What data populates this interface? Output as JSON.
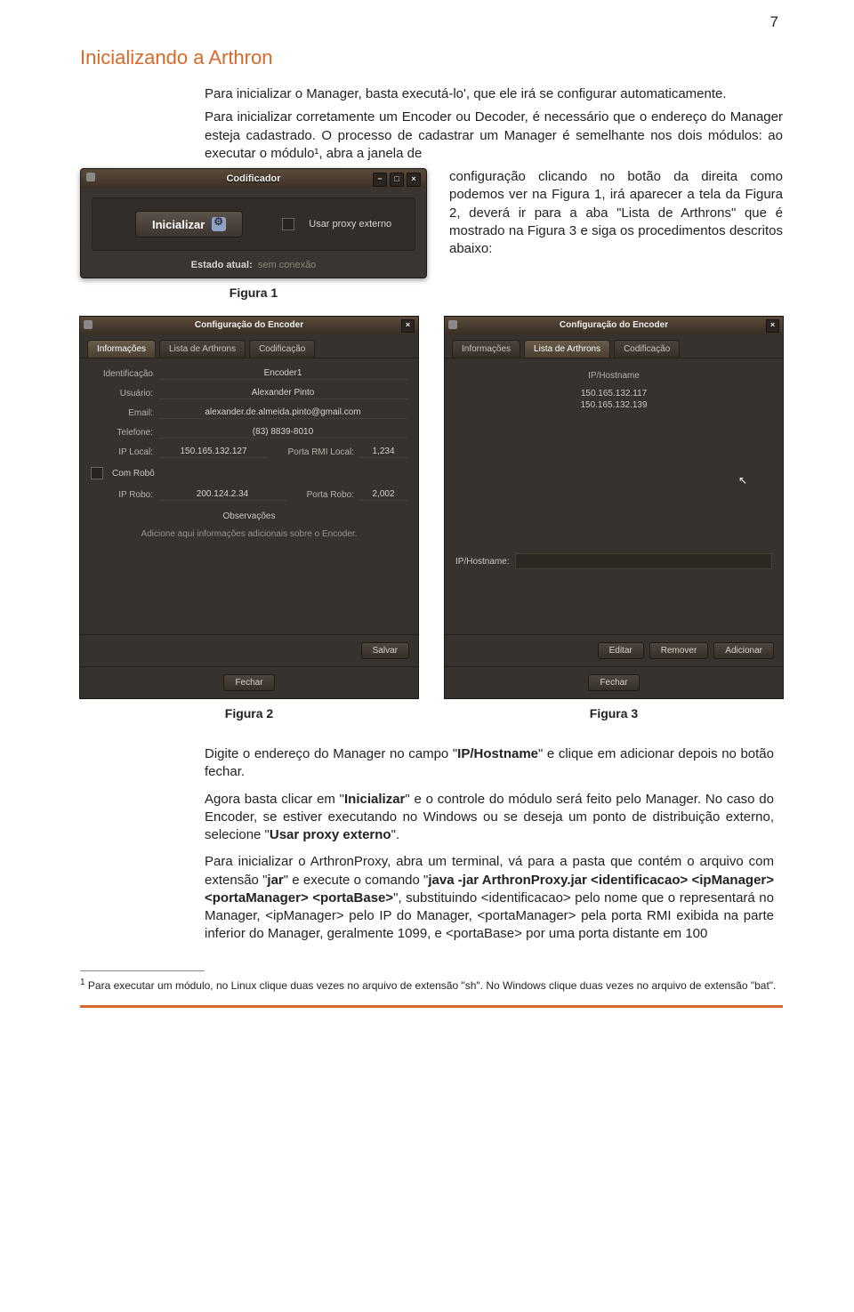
{
  "page_number": "7",
  "heading": "Inicializando a Arthron",
  "para1": "Para inicializar o Manager, basta executá-lo', que ele irá se configurar automaticamente.",
  "para2": "Para inicializar corretamente um Encoder ou Decoder, é necessário que o endereço do Manager esteja cadastrado. O processo de cadastrar um Manager é semelhante nos dois módulos: ao executar o módulo¹, abra a janela de",
  "para2b": "configuração clicando no botão da direita como podemos ver na Figura 1, irá aparecer a tela da Figura 2, deverá ir para a aba \"Lista de Arthrons\" que é mostrado na Figura 3 e siga os procedimentos descritos abaixo:",
  "fig1": {
    "title": "Codificador",
    "init_btn": "Inicializar",
    "proxy_label": "Usar proxy externo",
    "status_label": "Estado atual:",
    "status_value": "sem conexão",
    "caption": "Figura 1"
  },
  "fig2": {
    "title": "Configuração do Encoder",
    "tabs": {
      "info": "Informações",
      "lista": "Lista de Arthrons",
      "cod": "Codificação"
    },
    "labels": {
      "ident": "Identificação",
      "user": "Usuário:",
      "email": "Email:",
      "tel": "Telefone:",
      "iplocal": "IP Local:",
      "porta_rmi": "Porta RMI Local:",
      "com_robo": "Com Robô",
      "ip_robo": "IP Robo:",
      "porta_robo": "Porta Robo:",
      "obs": "Observações"
    },
    "vals": {
      "ident": "Encoder1",
      "user": "Alexander Pinto",
      "email": "alexander.de.almeida.pinto@gmail.com",
      "tel": "(83) 8839-8010",
      "iplocal": "150.165.132.127",
      "porta_rmi": "1,234",
      "ip_robo": "200.124.2.34",
      "porta_robo": "2,002",
      "obs": "Adicione aqui informações adicionais sobre o Encoder."
    },
    "save": "Salvar",
    "close": "Fechar",
    "caption": "Figura 2"
  },
  "fig3": {
    "title": "Configuração do Encoder",
    "col": "IP/Hostname",
    "ips": [
      "150.165.132.117",
      "150.165.132.139"
    ],
    "iphost_label": "IP/Hostname:",
    "btns": {
      "edit": "Editar",
      "rem": "Remover",
      "add": "Adicionar"
    },
    "close": "Fechar",
    "caption": "Figura 3"
  },
  "body": {
    "p1a": "Digite o endereço do Manager no campo \"",
    "p1b": "IP/Hostname",
    "p1c": "\" e clique em adicionar depois no botão fechar.",
    "p2a": "Agora basta clicar em \"",
    "p2b": "Inicializar",
    "p2c": "\" e o controle do módulo será feito pelo Manager. No caso do Encoder, se estiver executando no Windows ou se deseja um ponto de distribuição externo, selecione \"",
    "p2d": "Usar proxy externo",
    "p2e": "\".",
    "p3a": "Para inicializar o ArthronProxy, abra um terminal, vá para a pasta que contém o arquivo com extensão \"",
    "p3b": "jar",
    "p3c": "\" e execute o comando \"",
    "p3d": "java -jar ArthronProxy.jar <identificacao> <ipManager> <portaManager> <portaBase>",
    "p3e": "\", substituindo <identificacao> pelo nome que o representará no Manager, <ipManager> pelo IP do Manager, <portaManager> pela porta RMI exibida na parte inferior do Manager, geralmente 1099, e <portaBase> por uma porta distante em 100"
  },
  "footnote": {
    "num": "1",
    "text": " Para executar um módulo, no Linux clique duas vezes no arquivo de extensão \"sh\". No Windows clique duas vezes no arquivo de extensão \"bat\"."
  }
}
